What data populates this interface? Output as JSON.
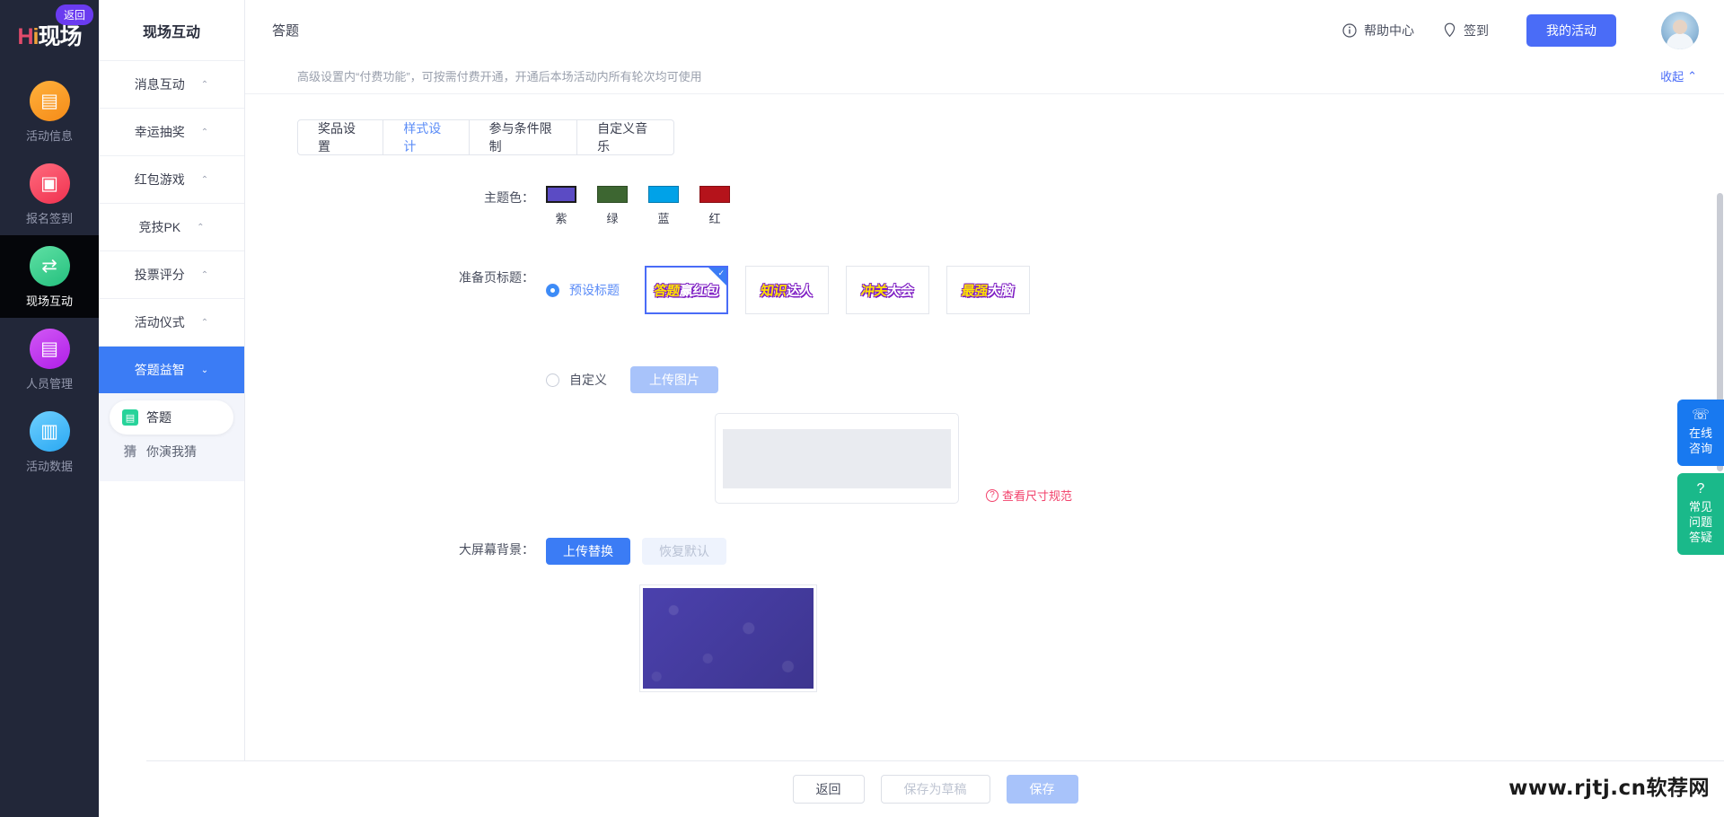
{
  "rail": {
    "logo": {
      "hi": "Hi",
      "name": "现场"
    },
    "back_label": "返回",
    "items": [
      {
        "label": "活动信息",
        "icon": "document-icon",
        "glyph": "▤",
        "active": false
      },
      {
        "label": "报名签到",
        "icon": "calendar-check-icon",
        "glyph": "▣",
        "active": false
      },
      {
        "label": "现场互动",
        "icon": "interaction-icon",
        "glyph": "⇄",
        "active": true
      },
      {
        "label": "人员管理",
        "icon": "user-card-icon",
        "glyph": "▤",
        "active": false
      },
      {
        "label": "活动数据",
        "icon": "bar-chart-icon",
        "glyph": "▥",
        "active": false
      }
    ]
  },
  "nav2": {
    "title": "现场互动",
    "rows": [
      {
        "label": "消息互动",
        "caret": "⌃",
        "selected": false
      },
      {
        "label": "幸运抽奖",
        "caret": "⌃",
        "selected": false
      },
      {
        "label": "红包游戏",
        "caret": "⌃",
        "selected": false
      },
      {
        "label": "竞技PK",
        "caret": "⌃",
        "selected": false
      },
      {
        "label": "投票评分",
        "caret": "⌃",
        "selected": false
      },
      {
        "label": "活动仪式",
        "caret": "⌃",
        "selected": false
      },
      {
        "label": "答题益智",
        "caret": "⌄",
        "selected": true
      }
    ],
    "sub_items": [
      {
        "label": "答题",
        "icon": "quiz-icon",
        "glyph": "▤",
        "selected": true
      },
      {
        "label": "你演我猜",
        "icon": "guess-icon",
        "glyph": "猜",
        "selected": false
      }
    ]
  },
  "topbar": {
    "title": "答题",
    "help": "帮助中心",
    "help_icon": "info-circle-icon",
    "signin": "签到",
    "signin_icon": "location-pin-icon",
    "my_activity": "我的活动",
    "avatar": "user-avatar"
  },
  "notice": {
    "text": "高级设置内“付费功能”，可按需付费开通，开通后本场活动内所有轮次均可使用",
    "collapse": "收起",
    "collapse_icon": "chevron-up-icon"
  },
  "tabs": [
    {
      "label": "奖品设置",
      "active": false
    },
    {
      "label": "样式设计",
      "active": true
    },
    {
      "label": "参与条件限制",
      "active": false
    },
    {
      "label": "自定义音乐",
      "active": false
    }
  ],
  "form": {
    "theme_color": {
      "label": "主题色：",
      "options": [
        {
          "name": "紫",
          "hex": "#5b4bc4",
          "selected": true
        },
        {
          "name": "绿",
          "hex": "#3d6631",
          "selected": false
        },
        {
          "name": "蓝",
          "hex": "#00a2e8",
          "selected": false
        },
        {
          "name": "红",
          "hex": "#b5131b",
          "selected": false
        }
      ]
    },
    "prep_title": {
      "label": "准备页标题：",
      "preset_radio": "预设标题",
      "preset_selected": true,
      "presets": [
        {
          "text1": "答题",
          "text2": "赢红包",
          "selected": true
        },
        {
          "text1": "知识",
          "text2": "达人",
          "selected": false
        },
        {
          "text1": "冲关",
          "text2": "大会",
          "selected": false
        },
        {
          "text1": "最强",
          "text2": "大脑",
          "selected": false
        }
      ],
      "custom_radio": "自定义",
      "custom_selected": false,
      "upload_button": "上传图片",
      "spec_link": "查看尺寸规范",
      "spec_icon": "question-circle-icon"
    },
    "screen_bg": {
      "label": "大屏幕背景：",
      "upload_button": "上传替换",
      "reset_button": "恢复默认"
    }
  },
  "bottombar": {
    "back": "返回",
    "draft": "保存为草稿",
    "save": "保存"
  },
  "floats": [
    {
      "icon": "headset-icon",
      "glyph": "☏",
      "line1": "在线",
      "line2": "咨询",
      "color": "#1879f0"
    },
    {
      "icon": "question-circle-icon",
      "glyph": "?",
      "line1": "常见",
      "line2": "问题",
      "line3": "答疑",
      "color": "#1ab98a"
    }
  ],
  "watermark": "www.rjtj.cn软荐网"
}
